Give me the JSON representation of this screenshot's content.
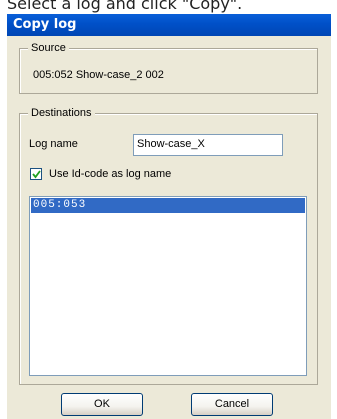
{
  "caption": "Select a log and click \"Copy\".",
  "window": {
    "title": "Copy log"
  },
  "source": {
    "legend": "Source",
    "value": "005:052  Show-case_2    002"
  },
  "destinations": {
    "legend": "Destinations",
    "log_name_label": "Log name",
    "log_name_value": "Show-case_X",
    "use_id_label": "Use Id-code as log name",
    "use_id_checked": true,
    "list_items": [
      "005:053"
    ]
  },
  "buttons": {
    "ok": "OK",
    "cancel": "Cancel"
  },
  "colors": {
    "titlebar": "#0050c8",
    "selection": "#316ac5",
    "dialog_bg": "#ece9d8"
  }
}
